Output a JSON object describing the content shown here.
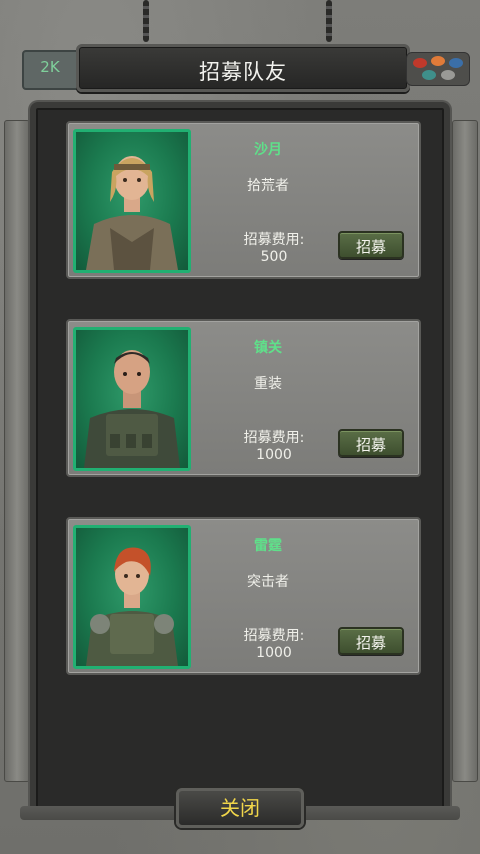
{
  "header": {
    "title": "招募队友",
    "level": "2K"
  },
  "colors": {
    "name_green": "#5fe08a",
    "portrait_bg": "#1b7a4f",
    "close_text": "#f1d64a"
  },
  "recruits": [
    {
      "name": "沙月",
      "role": "拾荒者",
      "cost_label": "招募费用:",
      "cost": "500",
      "button": "招募",
      "portrait": "female-scavenger-portrait"
    },
    {
      "name": "镇关",
      "role": "重装",
      "cost_label": "招募费用:",
      "cost": "1000",
      "button": "招募",
      "portrait": "male-heavy-armor-portrait"
    },
    {
      "name": "雷霆",
      "role": "突击者",
      "cost_label": "招募费用:",
      "cost": "1000",
      "button": "招募",
      "portrait": "female-assault-portrait"
    }
  ],
  "footer": {
    "close_label": "关闭"
  }
}
